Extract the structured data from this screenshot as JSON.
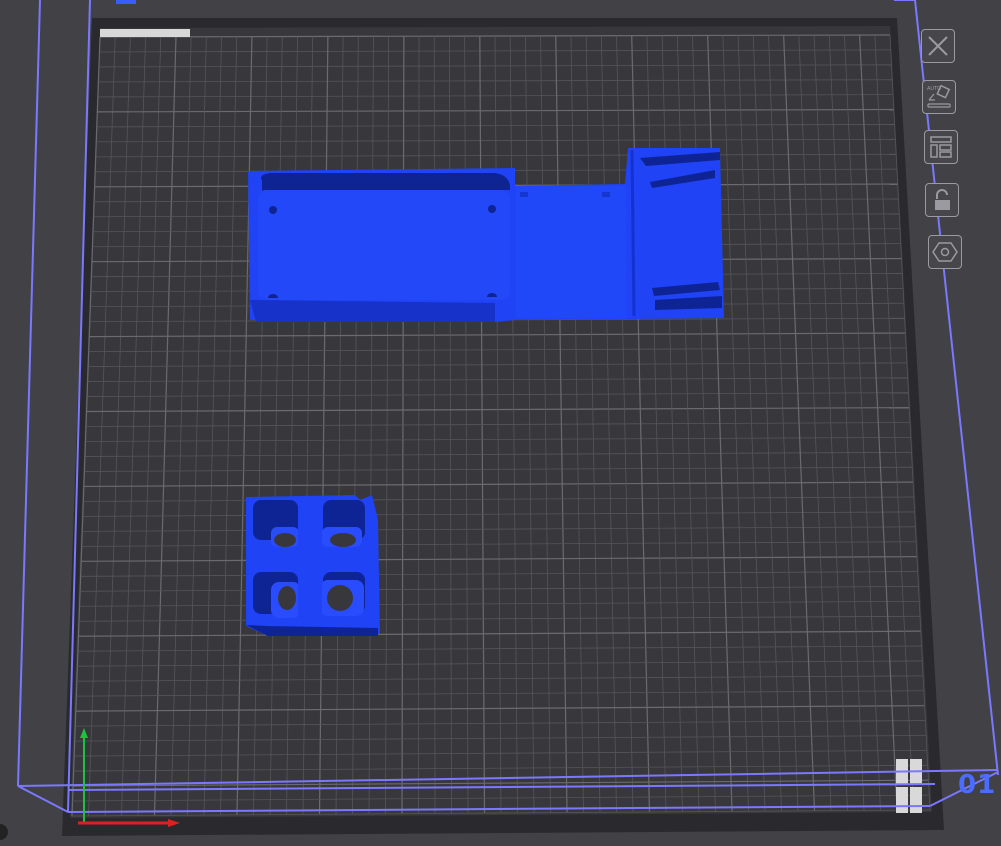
{
  "viewport": {
    "plate_number": "01",
    "colors": {
      "background": "#414146",
      "plate": "#38383c",
      "grid": "#55555a",
      "bounding_box": "#7b78ff",
      "model": "#1f43f5",
      "model_shadow": "#0f2494",
      "axis_x": "#e02020",
      "axis_y": "#20c040"
    }
  },
  "toolbar": {
    "items": [
      {
        "name": "close-icon"
      },
      {
        "name": "auto-orient-icon",
        "text": "AUTO"
      },
      {
        "name": "arrange-icon"
      },
      {
        "name": "lock-icon"
      },
      {
        "name": "settings-hex-icon"
      }
    ]
  }
}
